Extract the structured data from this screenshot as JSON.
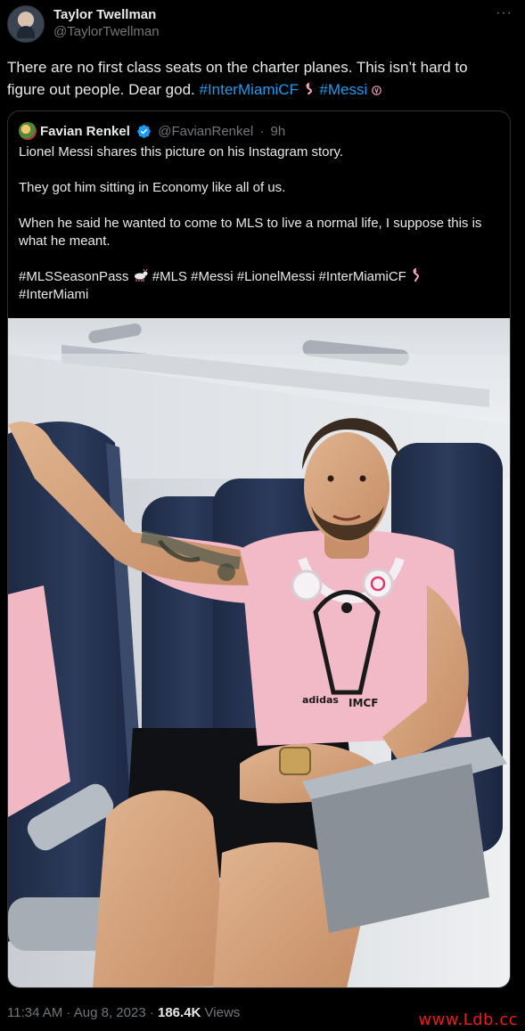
{
  "author": {
    "display_name": "Taylor Twellman",
    "handle": "@TaylorTwellman"
  },
  "tweet": {
    "text": "There are no first class seats on the charter planes. This isn’t hard to figure out people. Dear god. ",
    "hashtags": [
      "#InterMiamiCF",
      "#Messi"
    ]
  },
  "quoted_tweet": {
    "display_name": "Favian Renkel",
    "handle": "@FavianRenkel",
    "separator": "·",
    "age": "9h",
    "paragraphs": [
      "Lionel Messi shares this picture on his Instagram story.",
      "They got him sitting in Economy like all of us.",
      "When he said he wanted to come to MLS to live a normal life, I suppose this is what he meant."
    ],
    "hashtag_line": {
      "tag1": "#MLSSeasonPass",
      "tag2": "#MLS #Messi #LionelMessi #InterMiamiCF",
      "tag3": "#InterMiami"
    },
    "photo": {
      "shirt_text": "IMCF",
      "brand_text": "adidas"
    }
  },
  "footer": {
    "time_date": "11:34 AM · Aug 8, 2023 · ",
    "views_count": "186.4K",
    "views_label": " Views"
  },
  "watermark": "www.Ldb.cc",
  "colors": {
    "background": "#000000",
    "text": "#e7e9ea",
    "muted": "#71767b",
    "link": "#1d9bf0",
    "border": "#2f3336",
    "watermark": "#e81b1b"
  }
}
